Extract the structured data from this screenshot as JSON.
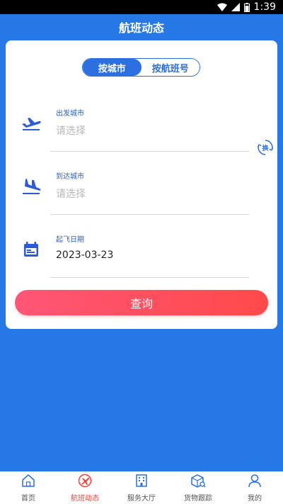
{
  "status_bar": {
    "time": "1:39"
  },
  "header": {
    "title": "航班动态"
  },
  "tabs": [
    {
      "label": "按城市",
      "active": true
    },
    {
      "label": "按航班号",
      "active": false
    }
  ],
  "form": {
    "departure": {
      "label": "出发城市",
      "placeholder": "请选择"
    },
    "arrival": {
      "label": "到达城市",
      "placeholder": "请选择"
    },
    "date": {
      "label": "起飞日期",
      "value": "2023-03-23"
    },
    "swap_label": "换",
    "query_button": "查询"
  },
  "bottom_nav": [
    {
      "label": "首页",
      "icon": "home-icon",
      "active": false
    },
    {
      "label": "航班动态",
      "icon": "flight-status-icon",
      "active": true
    },
    {
      "label": "服务大厅",
      "icon": "building-icon",
      "active": false
    },
    {
      "label": "货物跟踪",
      "icon": "cargo-tracking-icon",
      "active": false
    },
    {
      "label": "我的",
      "icon": "user-icon",
      "active": false
    }
  ],
  "colors": {
    "primary": "#2678e7",
    "accent": "#ff4a4a",
    "nav_active": "#ff3b30"
  }
}
